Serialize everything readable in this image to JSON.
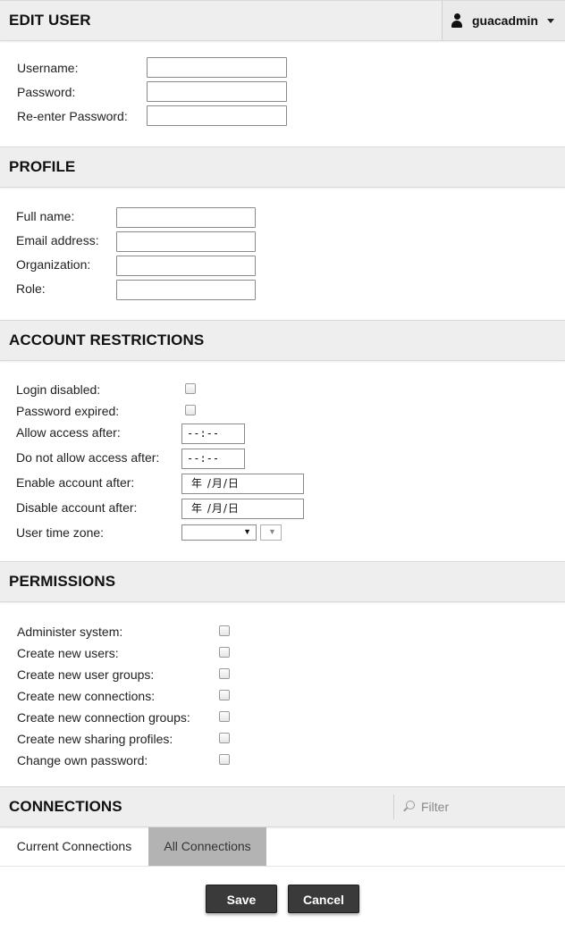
{
  "edit_user": {
    "title": "EDIT USER",
    "user_menu": {
      "username": "guacadmin"
    },
    "fields": [
      {
        "label": "Username:",
        "value": ""
      },
      {
        "label": "Password:",
        "value": ""
      },
      {
        "label": "Re-enter Password:",
        "value": ""
      }
    ]
  },
  "profile": {
    "title": "PROFILE",
    "fields": [
      {
        "label": "Full name:",
        "value": ""
      },
      {
        "label": "Email address:",
        "value": ""
      },
      {
        "label": "Organization:",
        "value": ""
      },
      {
        "label": "Role:",
        "value": ""
      }
    ]
  },
  "account_restrictions": {
    "title": "ACCOUNT RESTRICTIONS",
    "login_disabled": {
      "label": "Login disabled:",
      "checked": false
    },
    "password_expired": {
      "label": "Password expired:",
      "checked": false
    },
    "allow_access_after": {
      "label": "Allow access after:",
      "value": "--:--"
    },
    "do_not_allow_access_after": {
      "label": "Do not allow access after:",
      "value": "--:--"
    },
    "enable_account_after": {
      "label": "Enable account after:",
      "value": "年 /月/日"
    },
    "disable_account_after": {
      "label": "Disable account after:",
      "value": "年 /月/日"
    },
    "user_time_zone": {
      "label": "User time zone:",
      "value": ""
    }
  },
  "permissions": {
    "title": "PERMISSIONS",
    "items": [
      {
        "label": "Administer system:",
        "checked": false
      },
      {
        "label": "Create new users:",
        "checked": false
      },
      {
        "label": "Create new user groups:",
        "checked": false
      },
      {
        "label": "Create new connections:",
        "checked": false
      },
      {
        "label": "Create new connection groups:",
        "checked": false
      },
      {
        "label": "Create new sharing profiles:",
        "checked": false
      },
      {
        "label": "Change own password:",
        "checked": false
      }
    ]
  },
  "connections": {
    "title": "CONNECTIONS",
    "filter_placeholder": "Filter",
    "tabs": [
      {
        "label": "Current Connections",
        "active": false
      },
      {
        "label": "All Connections",
        "active": true
      }
    ]
  },
  "actions": {
    "save_label": "Save",
    "cancel_label": "Cancel"
  },
  "colors": {
    "header_bg": "#eeeeee",
    "button_bg": "#3a3a3a",
    "active_tab_bg": "#b3b3b3"
  }
}
